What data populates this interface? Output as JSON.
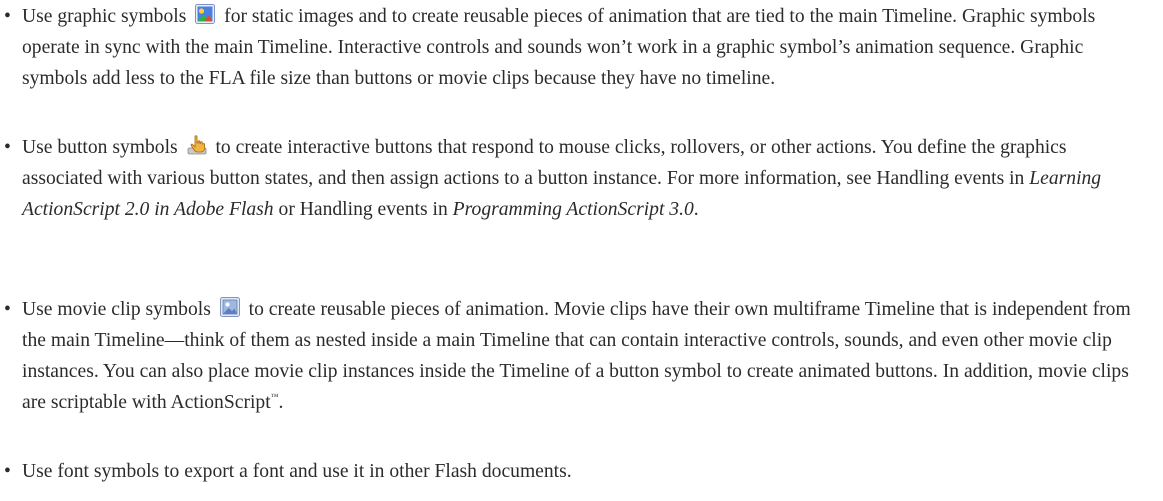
{
  "bullet_char": "•",
  "items": [
    {
      "part1": "Use graphic symbols",
      "icon": "graphic-symbol-icon",
      "part2": "for static images and to create reusable pieces of animation that are tied to the main Timeline. Graphic symbols operate in sync with the main Timeline. Interactive controls and sounds won’t work in a graphic symbol’s animation sequence. Graphic symbols add less to the FLA file size than buttons or movie clips because they have no timeline."
    },
    {
      "part1": "Use button symbols",
      "icon": "button-symbol-icon",
      "part2": "to create interactive buttons that respond to mouse clicks, rollovers, or other actions. You define the graphics associated with various button states, and then assign actions to a button instance. For more information, see Handling events in",
      "italic1": "Learning ActionScript 2.0 in Adobe Flash",
      "part3": "or Handling events in",
      "italic2": "Programming ActionScript 3.0",
      "part4": "."
    },
    {
      "part1": "Use movie clip symbols",
      "icon": "movie-clip-symbol-icon",
      "part2": "to create reusable pieces of animation. Movie clips have their own multiframe Timeline that is independent from the main Timeline—think of them as nested inside a main Timeline that can contain interactive controls, sounds, and even other movie clip instances. You can also place movie clip instances inside the Timeline of a button symbol to create animated buttons. In addition, movie clips are scriptable with ActionScript",
      "tm": "™",
      "part3": "."
    },
    {
      "part1": "Use font symbols to export a font and use it in other Flash documents."
    }
  ]
}
